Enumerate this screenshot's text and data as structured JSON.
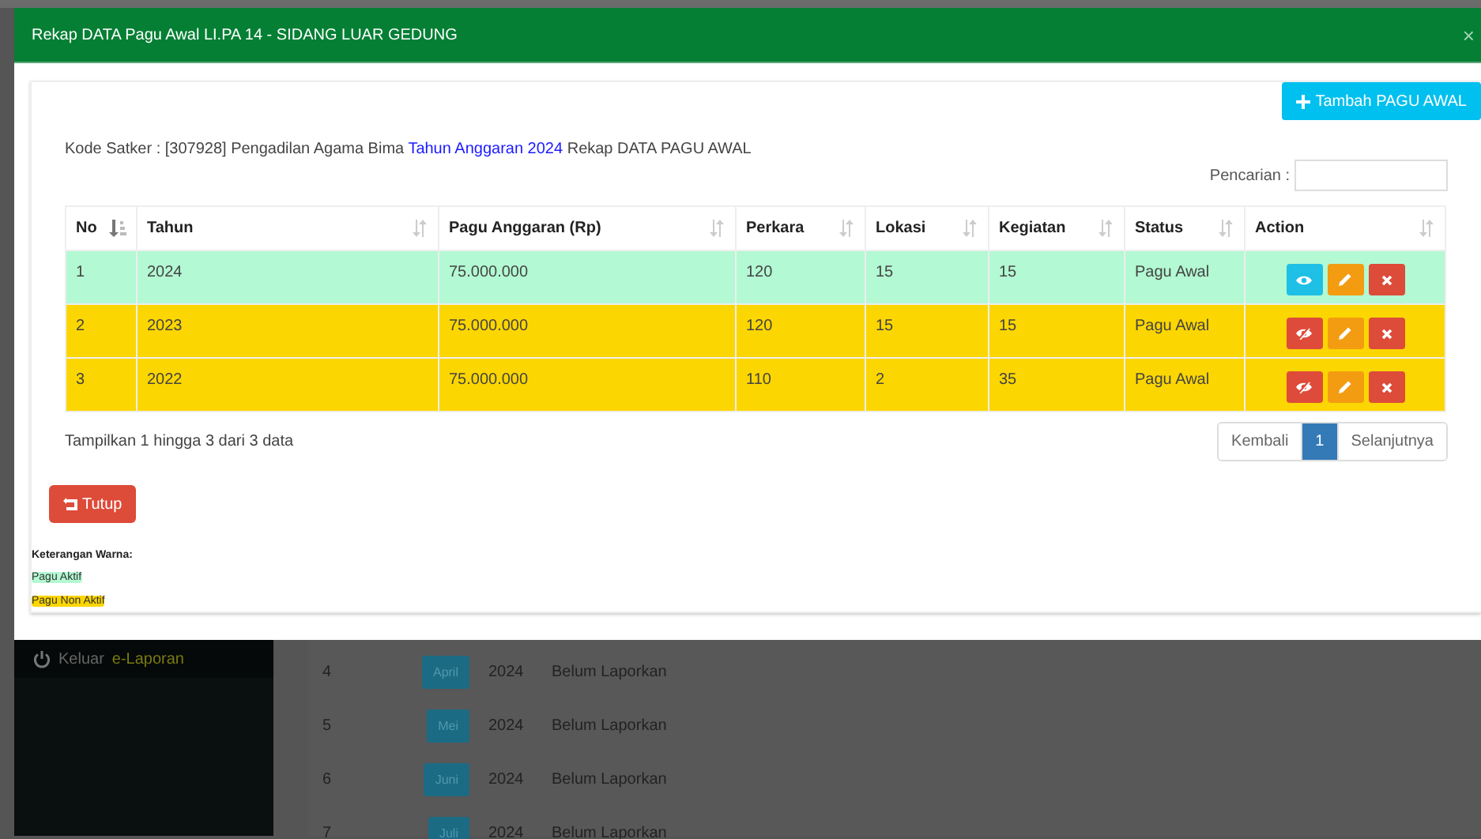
{
  "modal": {
    "title": "Rekap DATA Pagu Awal LI.PA 14 - SIDANG LUAR GEDUNG",
    "close": "×"
  },
  "add_button": "Tambah PAGU AWAL",
  "info": {
    "before": "Kode Satker : [307928] Pengadilan Agama Bima",
    "link": "Tahun Anggaran 2024",
    "after": "Rekap DATA PAGU AWAL"
  },
  "search": {
    "label": "Pencarian :"
  },
  "table": {
    "columns": [
      {
        "label": "No",
        "sorted": true
      },
      {
        "label": "Tahun",
        "sorted": false
      },
      {
        "label": "Pagu Anggaran (Rp)",
        "sorted": false
      },
      {
        "label": "Perkara",
        "sorted": false
      },
      {
        "label": "Lokasi",
        "sorted": false
      },
      {
        "label": "Kegiatan",
        "sorted": false
      },
      {
        "label": "Status",
        "sorted": false
      },
      {
        "label": "Action",
        "sorted": false
      }
    ],
    "rows": [
      {
        "no": "1",
        "tahun": "2024",
        "pagu": "75.000.000",
        "perkara": "120",
        "lokasi": "15",
        "kegiatan": "15",
        "status": "Pagu Awal",
        "active": true
      },
      {
        "no": "2",
        "tahun": "2023",
        "pagu": "75.000.000",
        "perkara": "120",
        "lokasi": "15",
        "kegiatan": "15",
        "status": "Pagu Awal",
        "active": false
      },
      {
        "no": "3",
        "tahun": "2022",
        "pagu": "75.000.000",
        "perkara": "110",
        "lokasi": "2",
        "kegiatan": "35",
        "status": "Pagu Awal",
        "active": false
      }
    ]
  },
  "table_info": "Tampilkan 1 hingga 3 dari 3 data",
  "pagination": [
    {
      "label": "Kembali",
      "selected": false
    },
    {
      "label": "1",
      "selected": true
    },
    {
      "label": "Selanjutnya",
      "selected": false
    }
  ],
  "close_button": "Tutup",
  "legend": {
    "title": "Keterangan Warna:",
    "items": [
      {
        "label": "Pagu Aktif",
        "color": "#b3f9d3"
      },
      {
        "label": "Pagu Non Aktif",
        "color": "#fcd600"
      }
    ]
  },
  "background": {
    "sidebar": {
      "label": "Keluar",
      "app": "e-Laporan"
    },
    "rows": [
      {
        "no": "4",
        "month": "April",
        "year": "2024",
        "status": "Belum Laporkan"
      },
      {
        "no": "5",
        "month": "Mei",
        "year": "2024",
        "status": "Belum Laporkan"
      },
      {
        "no": "6",
        "month": "Juni",
        "year": "2024",
        "status": "Belum Laporkan"
      },
      {
        "no": "7",
        "month": "Juli",
        "year": "2024",
        "status": "Belum Laporkan"
      }
    ]
  }
}
